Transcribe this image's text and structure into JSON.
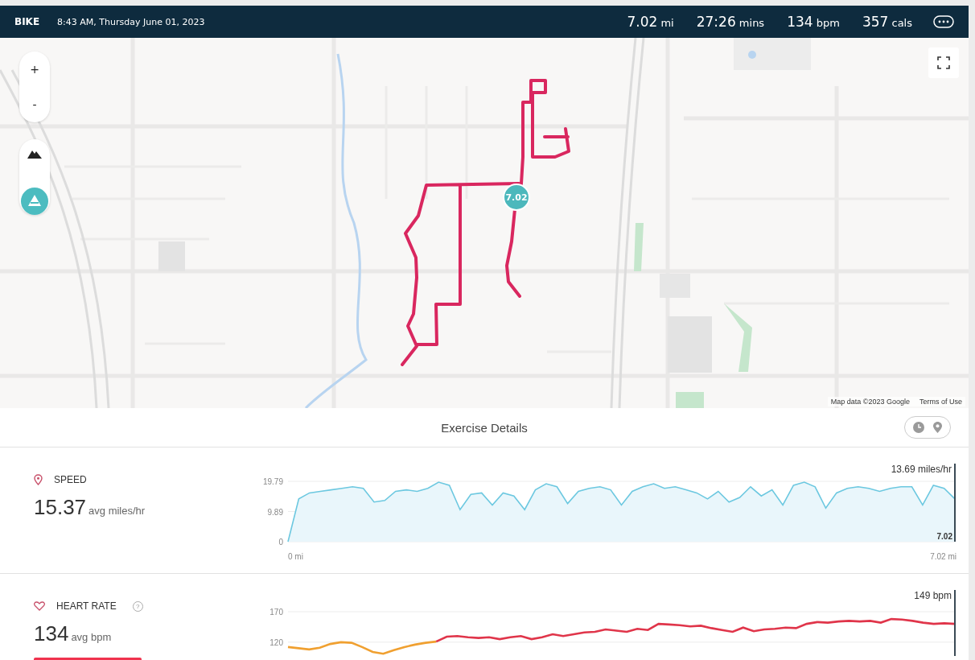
{
  "header": {
    "activity": "BIKE",
    "datetime": "8:43 AM, Thursday June 01, 2023",
    "stats": [
      {
        "value": "7.02",
        "unit": "mi"
      },
      {
        "value": "27:26",
        "unit": "mins"
      },
      {
        "value": "134",
        "unit": "bpm"
      },
      {
        "value": "357",
        "unit": "cals"
      }
    ]
  },
  "map": {
    "kind": "picture",
    "zoom_in": "+",
    "zoom_out": "-",
    "marker": "7.02",
    "attribution": "Map data ©2023 Google",
    "terms": "Terms of Use"
  },
  "details": {
    "title": "Exercise Details",
    "views": [
      {
        "kind": "time",
        "selected": false
      },
      {
        "kind": "distance",
        "selected": false
      }
    ]
  },
  "metrics": [
    {
      "kind": "speed",
      "label": "SPEED",
      "value": "15.37",
      "unit": "avg miles/hr",
      "readout": "13.69 miles/hr",
      "cursor_label": "7.02",
      "x_start": "0 mi",
      "x_end": "7.02 mi",
      "chart_data": {
        "type": "area",
        "ylim": [
          0,
          19.79
        ],
        "yticks": [
          0,
          9.89,
          19.79
        ],
        "series": [
          {
            "color": "#6cc8e0",
            "values": [
              0,
              14,
              16,
              16.5,
              17,
              17.5,
              18,
              17.5,
              13,
              13.5,
              16.5,
              17,
              16.5,
              17.5,
              19.5,
              18.5,
              10.5,
              15.5,
              16,
              12,
              16,
              15,
              10.5,
              17,
              19,
              18,
              12.5,
              16.5,
              17.5,
              18,
              17,
              12,
              16.5,
              18,
              19,
              17.5,
              18,
              17,
              16,
              14,
              16.5,
              13,
              14.5,
              18,
              15,
              17,
              12,
              18.5,
              19.5,
              18,
              11,
              16,
              17.5,
              18,
              17.5,
              16.5,
              17.5,
              18,
              18,
              12,
              18.5,
              17.5,
              14
            ]
          }
        ]
      }
    },
    {
      "kind": "heart",
      "label": "HEART RATE",
      "help": "?",
      "value": "134",
      "unit": "avg bpm",
      "readout": "149 bpm",
      "chart_data": {
        "type": "line",
        "ylim": [
          100,
          170
        ],
        "yticks": [
          120,
          170
        ],
        "series": [
          {
            "color": "#f0a030",
            "values": [
              112,
              110,
              108,
              111,
              117,
              120,
              119,
              112,
              104,
              101,
              107,
              112,
              116,
              119,
              121,
              null,
              null,
              null,
              null,
              null,
              null,
              null,
              null,
              null,
              null,
              null,
              null,
              null,
              null,
              null,
              null,
              null,
              null,
              null,
              null,
              null,
              null,
              null,
              null,
              null,
              null,
              null,
              null,
              null,
              null,
              null,
              null,
              null,
              null,
              null,
              null,
              null,
              null,
              null,
              null,
              null,
              null,
              null,
              null,
              null,
              null,
              null,
              null,
              null
            ]
          },
          {
            "color": "#e0354a",
            "values": [
              null,
              null,
              null,
              null,
              null,
              null,
              null,
              null,
              null,
              null,
              null,
              null,
              null,
              null,
              121,
              129,
              130,
              128,
              127,
              128,
              125,
              128,
              130,
              125,
              128,
              133,
              130,
              133,
              136,
              137,
              141,
              139,
              137,
              142,
              140,
              150,
              149,
              148,
              146,
              147,
              143,
              140,
              137,
              144,
              138,
              141,
              142,
              144,
              143,
              150,
              153,
              152,
              154,
              155,
              154,
              155,
              152,
              158,
              157,
              155,
              152,
              150,
              151,
              150
            ]
          }
        ]
      }
    }
  ]
}
